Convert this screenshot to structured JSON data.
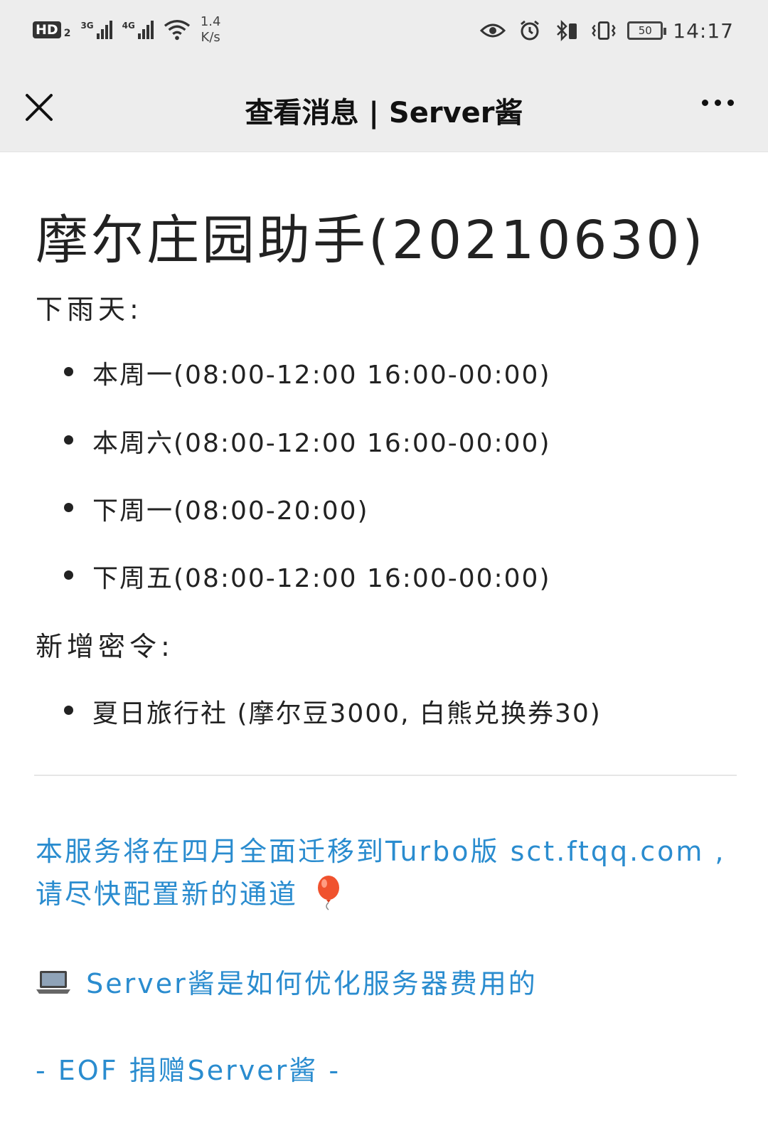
{
  "status_bar": {
    "hd_label": "HD",
    "hd_sub": "2",
    "signal1_label": "3G",
    "signal2_label": "4G",
    "speed_value": "1.4",
    "speed_unit": "K/s",
    "battery_level": "50",
    "time": "14:17",
    "icons": [
      "eye-icon",
      "alarm-icon",
      "bluetooth-icon",
      "vibrate-icon",
      "battery-icon"
    ]
  },
  "navbar": {
    "title": "查看消息 | Server酱",
    "close_icon": "close-icon",
    "more_icon": "more-icon"
  },
  "message": {
    "title": "摩尔庄园助手(20210630)",
    "rain_label": "下雨天:",
    "rain_items": [
      "本周一(08:00-12:00 16:00-00:00)",
      "本周六(08:00-12:00 16:00-00:00)",
      "下周一(08:00-20:00)",
      "下周五(08:00-12:00 16:00-00:00)"
    ],
    "password_label": "新增密令:",
    "password_items": [
      "夏日旅行社 (摩尔豆3000, 白熊兑换券30)"
    ]
  },
  "footer": {
    "notice_line1": "本服务将在四月全面迁移到Turbo版 sct.ftqq.com ,",
    "notice_line2": "请尽快配置新的通道",
    "article_link": "Server酱是如何优化服务器费用的",
    "eof_prefix": "- EOF ",
    "donate_link": "捐赠Server酱",
    "eof_suffix": " -",
    "link_color": "#2a8ccf"
  }
}
